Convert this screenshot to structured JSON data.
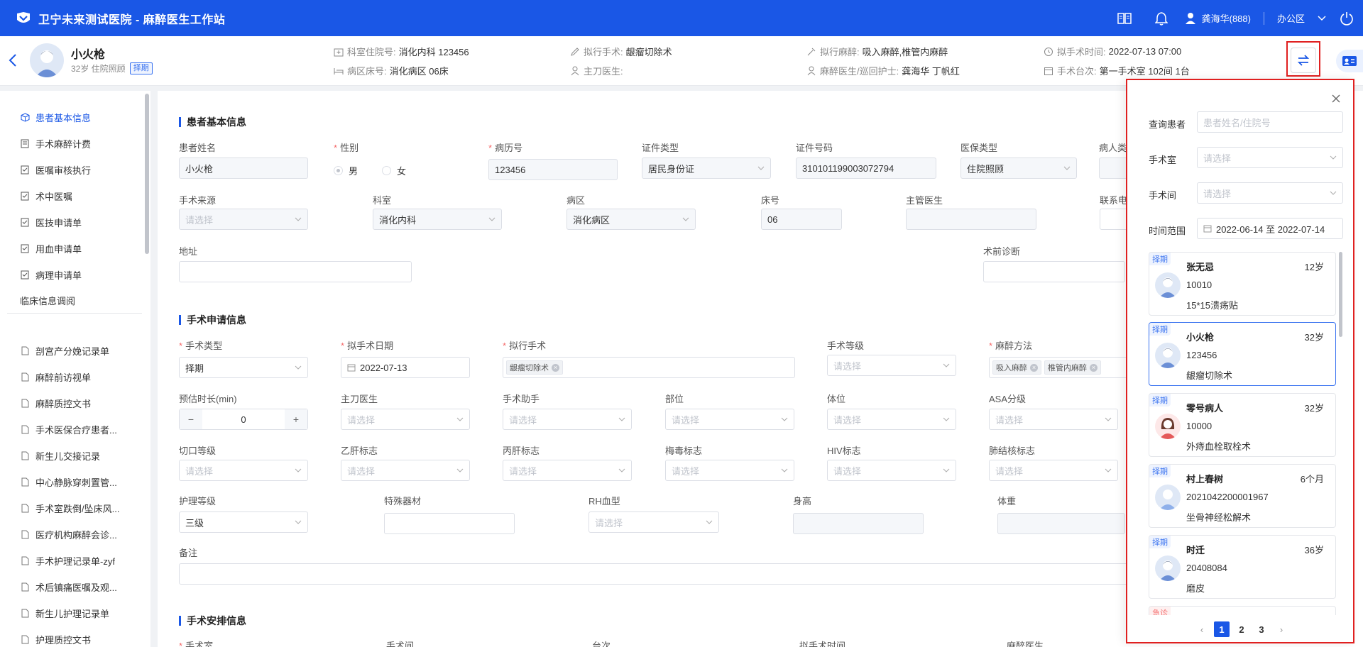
{
  "app": {
    "title": "卫宁未来测试医院 - 麻醉医生工作站"
  },
  "topbar": {
    "user": "龚海华(888)",
    "office": "办公区"
  },
  "patient": {
    "name": "小火枪",
    "meta": "32岁 住院照顾",
    "tag": "择期",
    "dept_no_label": "科室住院号:",
    "dept_no": "消化内科 123456",
    "ward_bed_label": "病区床号:",
    "ward_bed": "消化病区 06床",
    "planned_op_label": "拟行手术:",
    "planned_op": "龈瘤切除术",
    "surgeon_label": "主刀医生:",
    "surgeon": "",
    "planned_anes_label": "拟行麻醉:",
    "planned_anes": "吸入麻醉,椎管内麻醉",
    "anes_nurse_label": "麻醉医生/巡回护士:",
    "anes_nurse": "龚海华 丁帆红",
    "planned_time_label": "拟手术时间:",
    "planned_time": "2022-07-13 07:00",
    "op_room_label": "手术台次:",
    "op_room": "第一手术室 102间 1台"
  },
  "sidebar": {
    "items": [
      "患者基本信息",
      "手术麻醉计费",
      "医嘱审核执行",
      "术中医嘱",
      "医技申请单",
      "用血申请单",
      "病理申请单",
      "临床信息调阅"
    ],
    "docs": [
      "剖宫产分娩记录单",
      "麻醉前访视单",
      "麻醉质控文书",
      "手术医保合疗患者...",
      "新生儿交接记录",
      "中心静脉穿刺置管...",
      "手术室跌倒/坠床风...",
      "医疗机构麻醉会诊...",
      "手术护理记录单-zyf",
      "术后镇痛医嘱及观...",
      "新生儿护理记录单",
      "护理质控文书"
    ]
  },
  "sections": {
    "basic": "患者基本信息",
    "apply": "手术申请信息",
    "arrange": "手术安排信息"
  },
  "basic": {
    "name_label": "患者姓名",
    "name": "小火枪",
    "gender_label": "性别",
    "male": "男",
    "female": "女",
    "mrn_label": "病历号",
    "mrn": "123456",
    "idtype_label": "证件类型",
    "idtype": "居民身份证",
    "idno_label": "证件号码",
    "idno": "310101199003072794",
    "ins_label": "医保类型",
    "ins": "住院照顾",
    "ptype_label": "病人类型",
    "source_label": "手术来源",
    "source_ph": "请选择",
    "dept_label": "科室",
    "dept": "消化内科",
    "ward_label": "病区",
    "ward": "消化病区",
    "bed_label": "床号",
    "bed": "06",
    "doctor_label": "主管医生",
    "phone_label": "联系电话",
    "addr_label": "地址",
    "diag_label": "术前诊断"
  },
  "apply": {
    "optype_label": "手术类型",
    "optype": "择期",
    "opdate_label": "拟手术日期",
    "opdate": "2022-07-13",
    "op_label": "拟行手术",
    "op_chip": "龈瘤切除术",
    "oplevel_label": "手术等级",
    "ph": "请选择",
    "anes_label": "麻醉方法",
    "anes_chip1": "吸入麻醉",
    "anes_chip2": "椎管内麻醉",
    "dur_label": "预估时长(min)",
    "dur": "0",
    "surgeon_label": "主刀医生",
    "assist_label": "手术助手",
    "part_label": "部位",
    "pos_label": "体位",
    "asa_label": "ASA分级",
    "cut_label": "切口等级",
    "hbv_label": "乙肝标志",
    "hcv_label": "丙肝标志",
    "syph_label": "梅毒标志",
    "hiv_label": "HIV标志",
    "tb_label": "肺结核标志",
    "nurse_label": "护理等级",
    "nurse": "三级",
    "equip_label": "特殊器材",
    "rh_label": "RH血型",
    "height_label": "身高",
    "weight_label": "体重",
    "remark_label": "备注"
  },
  "arrange": {
    "room_label": "手术室",
    "oproom_label": "手术间",
    "seq_label": "台次",
    "time_label": "拟手术时间",
    "anesdoc_label": "麻醉医生"
  },
  "panel": {
    "query_label": "查询患者",
    "query_ph": "患者姓名/住院号",
    "room_label": "手术室",
    "room_ph": "请选择",
    "oproom_label": "手术间",
    "oproom_ph": "请选择",
    "range_label": "时间范围",
    "range": "2022-06-14 至 2022-07-14",
    "patients": [
      {
        "tag": "择期",
        "name": "张无忌",
        "age": "12岁",
        "id": "10010",
        "op": "15*15溃疡贴"
      },
      {
        "tag": "择期",
        "name": "小火枪",
        "age": "32岁",
        "id": "123456",
        "op": "龈瘤切除术"
      },
      {
        "tag": "择期",
        "name": "零号病人",
        "age": "32岁",
        "id": "10000",
        "op": "外痔血栓取栓术"
      },
      {
        "tag": "择期",
        "name": "村上春树",
        "age": "6个月",
        "id": "2021042200001967",
        "op": "坐骨神经松解术"
      },
      {
        "tag": "择期",
        "name": "时迁",
        "age": "36岁",
        "id": "20408084",
        "op": "磨皮"
      },
      {
        "tag": "急诊",
        "name": "",
        "age": "",
        "id": "",
        "op": ""
      }
    ],
    "pages": [
      "1",
      "2",
      "3"
    ]
  },
  "colors": {
    "brand": "#1a57e6",
    "highlight": "#e02020"
  }
}
